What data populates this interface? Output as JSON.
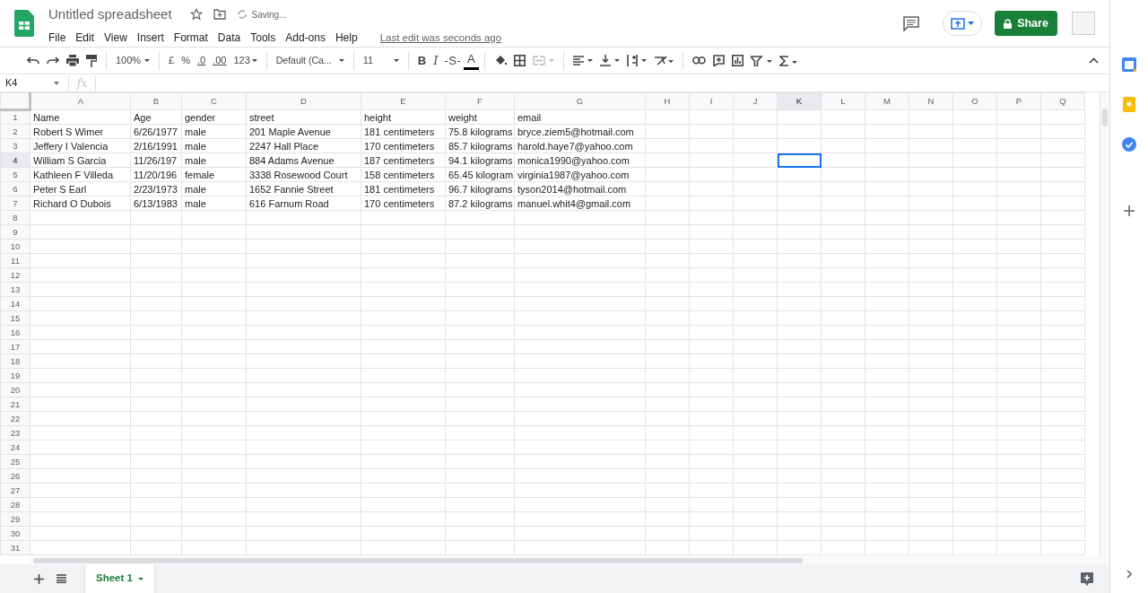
{
  "document": {
    "title": "Untitled spreadsheet",
    "save_status": "Saving...",
    "last_edit": "Last edit was seconds ago"
  },
  "menu": [
    "File",
    "Edit",
    "View",
    "Insert",
    "Format",
    "Data",
    "Tools",
    "Add-ons",
    "Help"
  ],
  "share_button": "Share",
  "toolbar": {
    "zoom": "100%",
    "currency": "£",
    "percent": "%",
    "decrease_decimal": ".0",
    "increase_decimal": ".00",
    "number_format": "123",
    "font": "Default (Ca...",
    "font_size": "11",
    "bold": "B",
    "italic": "I",
    "strikethrough": "S",
    "text_color": "A"
  },
  "name_box": "K4",
  "formula_label": "fx",
  "columns": [
    {
      "label": "A",
      "selected": false
    },
    {
      "label": "B",
      "selected": false
    },
    {
      "label": "C",
      "selected": false
    },
    {
      "label": "D",
      "selected": false
    },
    {
      "label": "E",
      "selected": false
    },
    {
      "label": "F",
      "selected": false
    },
    {
      "label": "G",
      "selected": false
    },
    {
      "label": "H",
      "selected": false
    },
    {
      "label": "I",
      "selected": false
    },
    {
      "label": "J",
      "selected": false
    },
    {
      "label": "K",
      "selected": true
    },
    {
      "label": "L",
      "selected": false
    },
    {
      "label": "M",
      "selected": false
    },
    {
      "label": "N",
      "selected": false
    },
    {
      "label": "O",
      "selected": false
    },
    {
      "label": "P",
      "selected": false
    },
    {
      "label": "Q",
      "selected": false
    }
  ],
  "rows": [
    {
      "label": "1",
      "selected": false,
      "cells": [
        "Name",
        "Age",
        "gender",
        "street",
        "height",
        "weight",
        "email"
      ]
    },
    {
      "label": "2",
      "selected": false,
      "cells": [
        "Robert S Wimer",
        "6/26/1977",
        "male",
        "201 Maple Avenue",
        "181 centimeters",
        "75.8 kilograms",
        "bryce.ziem5@hotmail.com"
      ]
    },
    {
      "label": "3",
      "selected": false,
      "cells": [
        "Jeffery I Valencia",
        "2/16/1991",
        "male",
        "2247 Hall Place",
        "170 centimeters",
        "85.7 kilograms",
        "harold.haye7@yahoo.com"
      ]
    },
    {
      "label": "4",
      "selected": true,
      "cells": [
        "William S Garcia",
        "11/26/197",
        "male",
        "884 Adams Avenue",
        "187 centimeters",
        "94.1 kilograms",
        "monica1990@yahoo.com"
      ]
    },
    {
      "label": "5",
      "selected": false,
      "cells": [
        "Kathleen F Villeda",
        "11/20/196",
        "female",
        "3338 Rosewood Court",
        "158 centimeters",
        "65.45 kilogram",
        "virginia1987@yahoo.com"
      ]
    },
    {
      "label": "6",
      "selected": false,
      "cells": [
        "Peter S Earl",
        "2/23/1973",
        "male",
        "1652 Fannie Street",
        "181 centimeters",
        "96.7 kilograms",
        "tyson2014@hotmail.com"
      ]
    },
    {
      "label": "7",
      "selected": false,
      "cells": [
        "Richard O Dubois",
        "6/13/1983",
        "male",
        "616 Farnum Road",
        "170 centimeters",
        "87.2 kilograms",
        "manuel.whit4@gmail.com"
      ]
    },
    {
      "label": "8",
      "selected": false
    },
    {
      "label": "9",
      "selected": false
    },
    {
      "label": "10",
      "selected": false
    },
    {
      "label": "11",
      "selected": false
    },
    {
      "label": "12",
      "selected": false
    },
    {
      "label": "13",
      "selected": false
    },
    {
      "label": "14",
      "selected": false
    },
    {
      "label": "15",
      "selected": false
    },
    {
      "label": "16",
      "selected": false
    },
    {
      "label": "17",
      "selected": false
    },
    {
      "label": "18",
      "selected": false
    },
    {
      "label": "19",
      "selected": false
    },
    {
      "label": "20",
      "selected": false
    },
    {
      "label": "21",
      "selected": false
    },
    {
      "label": "22",
      "selected": false
    },
    {
      "label": "23",
      "selected": false
    },
    {
      "label": "24",
      "selected": false
    },
    {
      "label": "25",
      "selected": false
    },
    {
      "label": "26",
      "selected": false
    },
    {
      "label": "27",
      "selected": false
    },
    {
      "label": "28",
      "selected": false
    },
    {
      "label": "29",
      "selected": false
    },
    {
      "label": "30",
      "selected": false
    },
    {
      "label": "31",
      "selected": false
    }
  ],
  "sheets": [
    {
      "label": "Sheet 1",
      "selected": true
    }
  ]
}
